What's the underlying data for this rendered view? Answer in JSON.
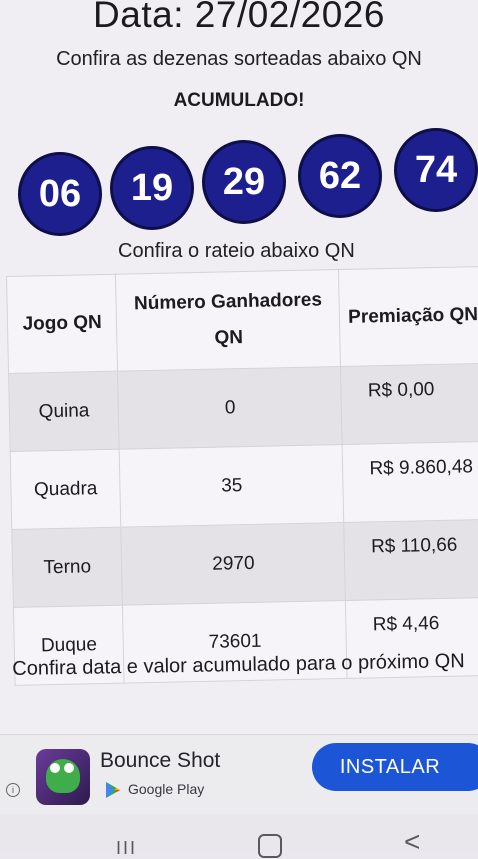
{
  "header": {
    "date_title": "Data: 27/02/2026",
    "subtitle": "Confira as dezenas sorteadas abaixo QN",
    "status": "ACUMULADO!"
  },
  "drawn_numbers": [
    "06",
    "19",
    "29",
    "62",
    "74"
  ],
  "rateio": {
    "title": "Confira o rateio abaixo QN",
    "headers": {
      "jogo": "Jogo QN",
      "ganhadores": "Número Ganhadores QN",
      "premiacao": "Premiação QN"
    },
    "rows": [
      {
        "jogo": "Quina",
        "ganhadores": "0",
        "premiacao": "R$ 0,00"
      },
      {
        "jogo": "Quadra",
        "ganhadores": "35",
        "premiacao": "R$ 9.860,48"
      },
      {
        "jogo": "Terno",
        "ganhadores": "2970",
        "premiacao": "R$ 110,66"
      },
      {
        "jogo": "Duque",
        "ganhadores": "73601",
        "premiacao": "R$ 4,46"
      }
    ]
  },
  "next_info": "Confira data e valor acumulado para o próximo QN",
  "ad": {
    "app_name": "Bounce Shot",
    "store": "Google Play",
    "install_label": "INSTALAR"
  },
  "nav": {
    "recent": "III",
    "back": "<"
  },
  "colors": {
    "ball": "#1d1f8e",
    "install_button": "#1c56d6"
  }
}
